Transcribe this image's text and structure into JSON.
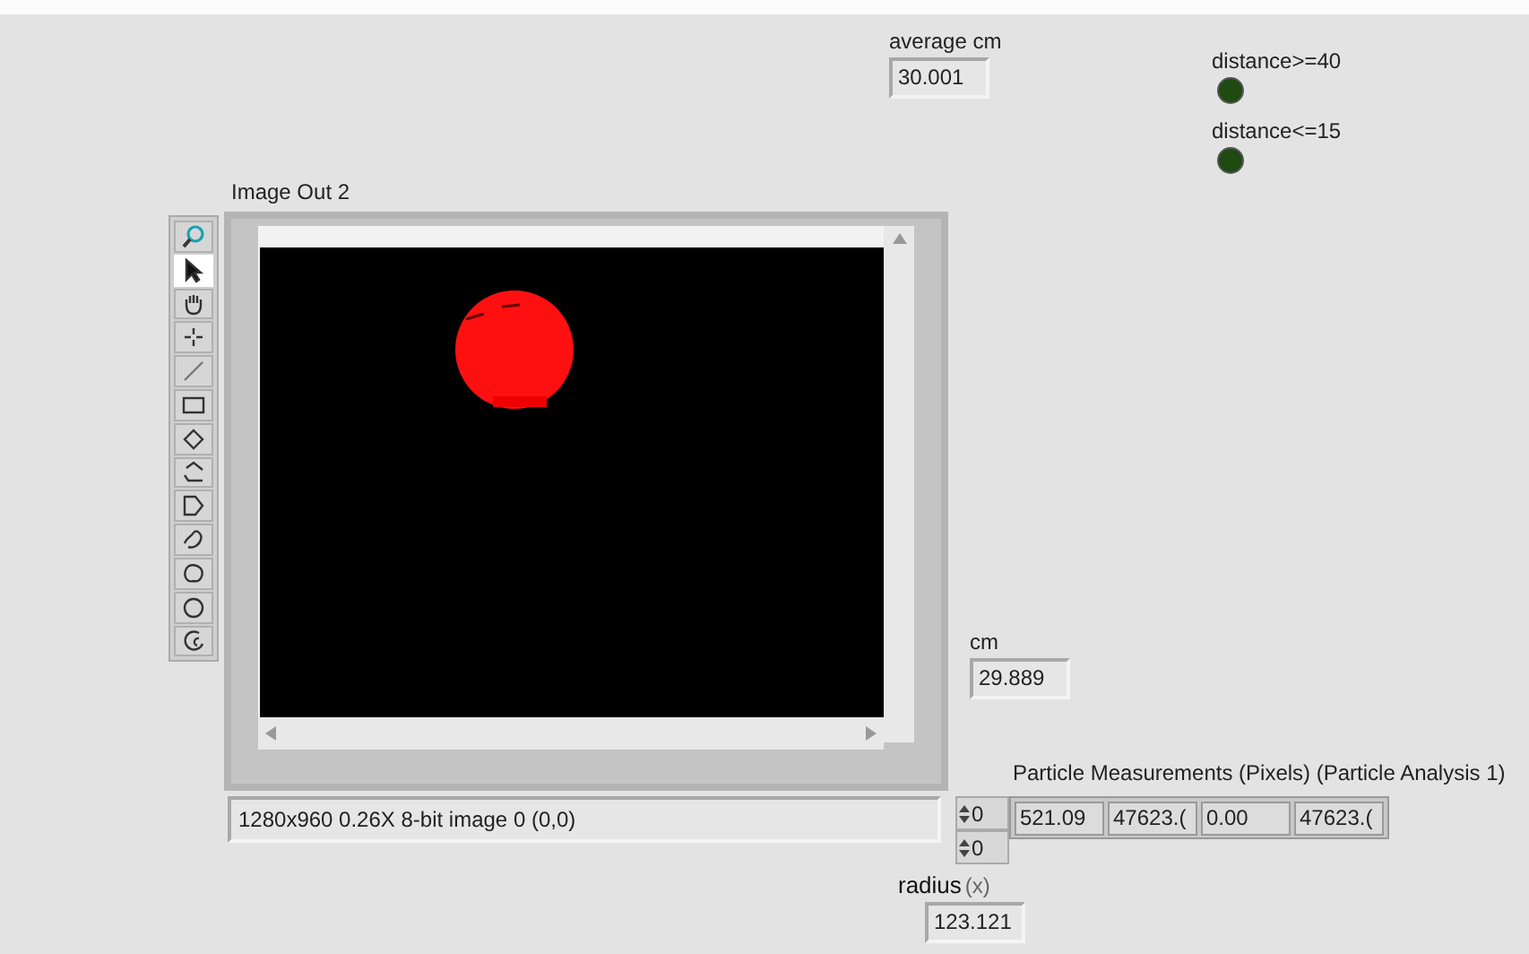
{
  "indicators": [
    {
      "label": "average cm",
      "value": "30.001"
    },
    {
      "label": "cm",
      "value": "29.889"
    }
  ],
  "leds": [
    {
      "label": "distance>=40",
      "on": false
    },
    {
      "label": "distance<=15",
      "on": false
    }
  ],
  "image_display": {
    "label": "Image Out 2",
    "status": "1280x960 0.26X 8-bit image 0    (0,0)",
    "tools": [
      {
        "kind": "zoom",
        "selected": false
      },
      {
        "kind": "pointer",
        "selected": true
      },
      {
        "kind": "pan",
        "selected": false
      },
      {
        "kind": "point",
        "selected": false
      },
      {
        "kind": "line",
        "selected": false
      },
      {
        "kind": "rectangle",
        "selected": false
      },
      {
        "kind": "rotated-rectangle",
        "selected": false
      },
      {
        "kind": "polyline",
        "selected": false
      },
      {
        "kind": "polygon",
        "selected": false
      },
      {
        "kind": "freehand-line",
        "selected": false
      },
      {
        "kind": "freehand-region",
        "selected": false
      },
      {
        "kind": "oval",
        "selected": false
      },
      {
        "kind": "annulus",
        "selected": false
      }
    ]
  },
  "particle_measurements": {
    "label": "Particle Measurements (Pixels) (Particle Analysis 1)",
    "indices": [
      "0",
      "0"
    ],
    "values": [
      "521.09",
      "47623.(",
      "0.00",
      "47623.("
    ]
  },
  "radius": {
    "label": "radius",
    "unit": "(x)",
    "value": "123.121"
  }
}
